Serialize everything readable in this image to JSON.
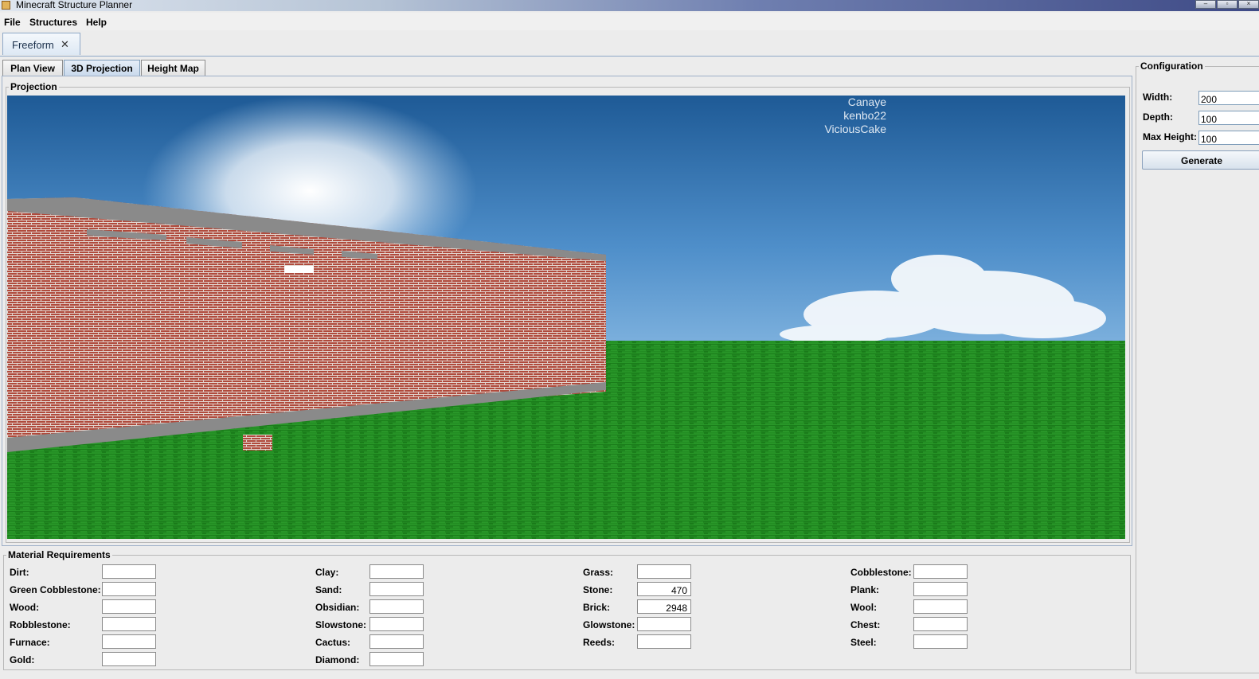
{
  "window": {
    "title": "Minecraft Structure Planner",
    "buttons": [
      "–",
      "▫",
      "×"
    ]
  },
  "menu": {
    "items": [
      "File",
      "Structures",
      "Help"
    ]
  },
  "doc_tab": {
    "label": "Freeform",
    "close": "✕"
  },
  "view_tabs": [
    "Plan View",
    "3D Projection",
    "Height Map"
  ],
  "projection": {
    "legend": "Projection",
    "credits": [
      "Canaye",
      "kenbo22",
      "ViciousCake"
    ]
  },
  "materials": {
    "legend": "Material Requirements",
    "columns": [
      [
        {
          "label": "Dirt:",
          "value": ""
        },
        {
          "label": "Green Cobblestone:",
          "value": ""
        },
        {
          "label": "Wood:",
          "value": ""
        },
        {
          "label": "Robblestone:",
          "value": ""
        },
        {
          "label": "Furnace:",
          "value": ""
        },
        {
          "label": "Gold:",
          "value": ""
        }
      ],
      [
        {
          "label": "Clay:",
          "value": ""
        },
        {
          "label": "Sand:",
          "value": ""
        },
        {
          "label": "Obsidian:",
          "value": ""
        },
        {
          "label": "Slowstone:",
          "value": ""
        },
        {
          "label": "Cactus:",
          "value": ""
        },
        {
          "label": "Diamond:",
          "value": ""
        }
      ],
      [
        {
          "label": "Grass:",
          "value": ""
        },
        {
          "label": "Stone:",
          "value": "470"
        },
        {
          "label": "Brick:",
          "value": "2948"
        },
        {
          "label": "Glowstone:",
          "value": ""
        },
        {
          "label": "Reeds:",
          "value": ""
        }
      ],
      [
        {
          "label": "Cobblestone:",
          "value": ""
        },
        {
          "label": "Plank:",
          "value": ""
        },
        {
          "label": "Wool:",
          "value": ""
        },
        {
          "label": "Chest:",
          "value": ""
        },
        {
          "label": "Steel:",
          "value": ""
        }
      ]
    ]
  },
  "config": {
    "legend": "Configuration",
    "width_label": "Width:",
    "width_value": "200",
    "depth_label": "Depth:",
    "depth_value": "100",
    "maxheight_label": "Max Height:",
    "maxheight_value": "100",
    "generate_label": "Generate"
  },
  "colors": {
    "sky_top": "#1e5a96",
    "sky_bottom": "#6fa6d8",
    "grass": "#1f8a1f",
    "brick": "#a8463a",
    "stone": "#8c8c8c"
  }
}
